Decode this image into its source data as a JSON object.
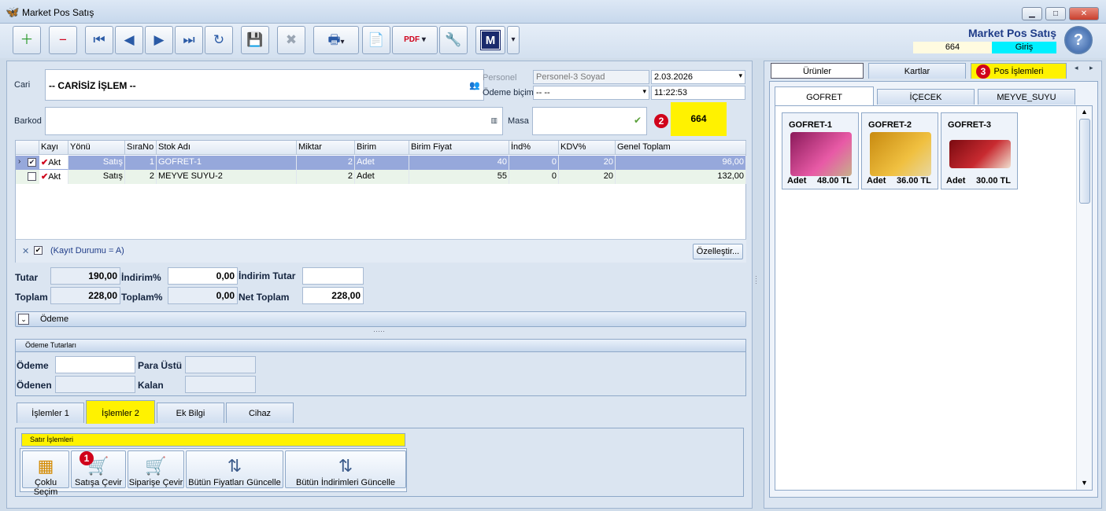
{
  "window": {
    "title": "Market Pos Satış",
    "minimize": "▁",
    "maximize": "□",
    "close": "✕"
  },
  "header": {
    "title": "Market Pos Satış",
    "masa_no": "664",
    "mode": "Giriş",
    "help": "?"
  },
  "toolbar": {
    "buttons": [
      "add-record-icon",
      "delete-record-icon",
      "first-record-icon",
      "prev-record-icon",
      "next-record-icon",
      "last-record-icon",
      "refresh-icon",
      "save-icon",
      "cancel-save-icon",
      "print-icon",
      "new-page-icon",
      "pdf-export-icon",
      "tools-icon",
      "m-logo-icon"
    ],
    "glyphs": {
      "add": "＋",
      "delete": "−",
      "first": "⏮",
      "prev": "◀",
      "next": "▶",
      "last": "⏭",
      "refresh": "↻",
      "save": "💾",
      "cancel": "✖",
      "print": "🖶",
      "page": "📄",
      "pdf": "PDF",
      "tools": "🔧",
      "m": "M",
      "dropdown": "▾"
    }
  },
  "form": {
    "cari_label": "Cari",
    "cari_value": "-- CARİSİZ İŞLEM --",
    "barkod_label": "Barkod",
    "barkod_value": "",
    "personel_label": "Personel",
    "personel_value": "Personel-3 Soyad",
    "odeme_bicimi_label": "Ödeme biçimi",
    "odeme_bicimi_value": "-- --",
    "date": "2.03.2026",
    "time": "11:22:53",
    "masa_label": "Masa",
    "masa_value": "",
    "masa_number": "664"
  },
  "grid": {
    "columns": [
      "Kayı",
      "Yönü",
      "SıraNo",
      "Stok Adı",
      "Miktar",
      "Birim",
      "Birim Fiyat",
      "İnd%",
      "KDV%",
      "Genel Toplam"
    ],
    "rows": [
      {
        "kayit": "Akt",
        "yonu": "Satış",
        "sira": "1",
        "stok": "GOFRET-1",
        "miktar": "2",
        "birim": "Adet",
        "fiyat": "40",
        "ind": "0",
        "kdv": "20",
        "toplam": "96,00"
      },
      {
        "kayit": "Akt",
        "yonu": "Satış",
        "sira": "2",
        "stok": "MEYVE SUYU-2",
        "miktar": "2",
        "birim": "Adet",
        "fiyat": "55",
        "ind": "0",
        "kdv": "20",
        "toplam": "132,00"
      }
    ],
    "filter_text": "(Kayıt Durumu = A)",
    "customize_button": "Özelleştir..."
  },
  "totals": {
    "tutar_label": "Tutar",
    "tutar": "190,00",
    "indirim_pct_label": "İndirim%",
    "indirim_pct": "0,00",
    "indirim_tutar_label": "İndirim Tutar",
    "indirim_tutar": "",
    "toplam_label": "Toplam",
    "toplam": "228,00",
    "toplam_pct_label": "Toplam%",
    "toplam_pct": "0,00",
    "net_toplam_label": "Net Toplam",
    "net_toplam": "228,00"
  },
  "odeme_bar": {
    "label": "Ödeme"
  },
  "odeme_tutarlari": {
    "title": "Ödeme Tutarları",
    "odeme_label": "Ödeme",
    "odeme": "",
    "para_ustu_label": "Para Üstü",
    "para_ustu": "",
    "odenen_label": "Ödenen",
    "odenen": "",
    "kalan_label": "Kalan",
    "kalan": ""
  },
  "bottom_tabs": [
    "İşlemler 1",
    "İşlemler 2",
    "Ek Bilgi",
    "Cihaz"
  ],
  "satir_islemleri": {
    "title": "Satır İşlemleri",
    "buttons": [
      "Çoklu Seçim",
      "Satışa Çevir",
      "Siparişe Çevir",
      "Bütün Fiyatları Güncelle",
      "Bütün İndirimleri Güncelle"
    ]
  },
  "badges": [
    "1",
    "2",
    "3"
  ],
  "right": {
    "tabs": [
      "Ürünler",
      "Kartlar",
      "Pos İşlemleri"
    ],
    "categories": [
      "GOFRET",
      "İÇECEK",
      "MEYVE_SUYU"
    ],
    "products": [
      {
        "name": "GOFRET-1",
        "unit": "Adet",
        "price": "48.00 TL"
      },
      {
        "name": "GOFRET-2",
        "unit": "Adet",
        "price": "36.00 TL"
      },
      {
        "name": "GOFRET-3",
        "unit": "Adet",
        "price": "30.00 TL"
      }
    ]
  },
  "colors": {
    "highlight": "#fff200",
    "accent": "#1f3c88",
    "badge": "#d0021b",
    "giris": "#00f0ff"
  }
}
